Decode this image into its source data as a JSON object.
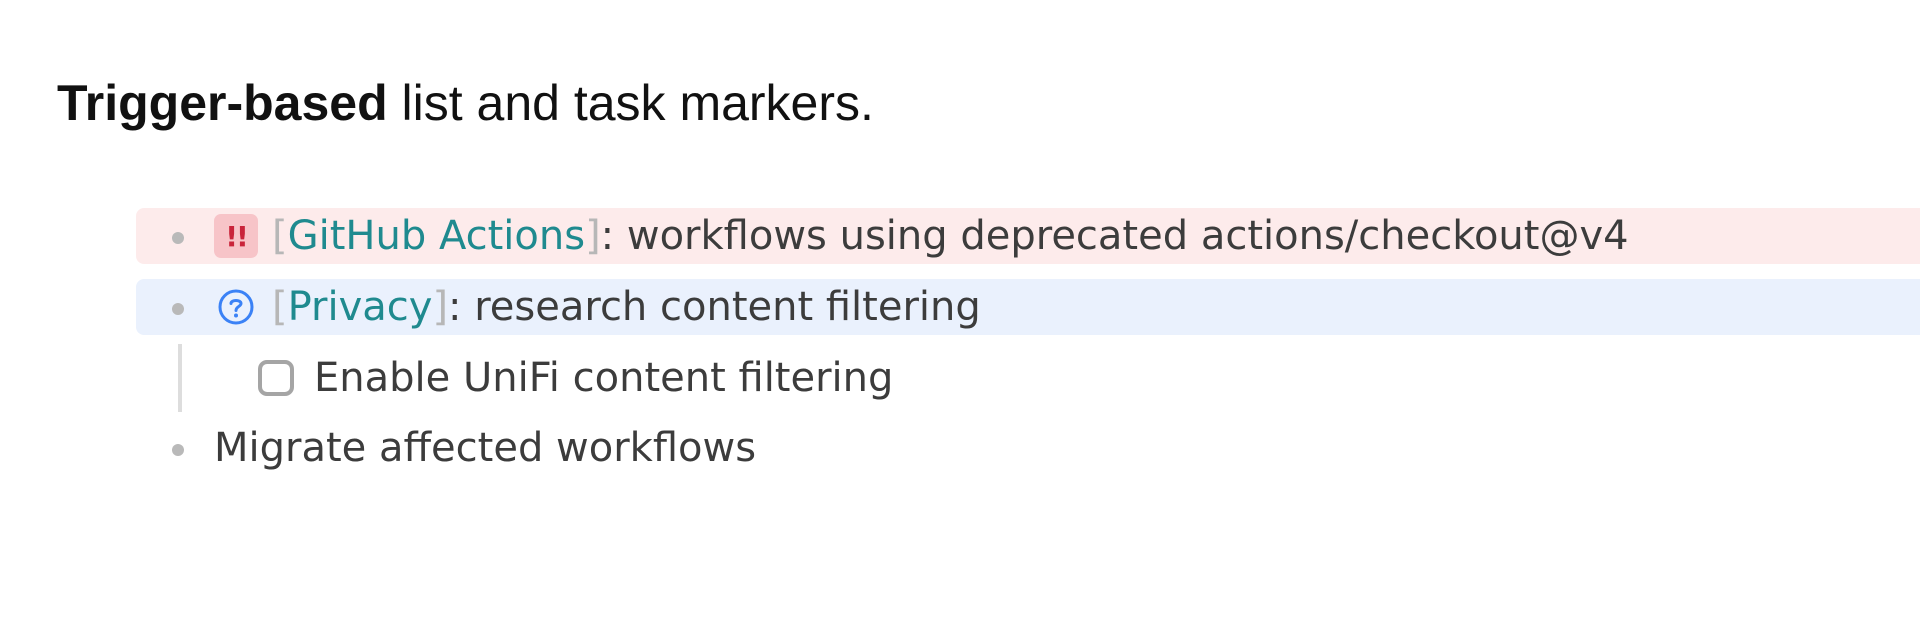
{
  "heading": {
    "bold": "Trigger-based",
    "rest": " list and task markers."
  },
  "items": [
    {
      "marker": "!!",
      "marker_icon": "double-exclamation-icon",
      "marker_color": "#c9243a",
      "highlight": "#fdebeb",
      "bracket_open": "[",
      "tag": "GitHub Actions",
      "bracket_close": "]",
      "text": ": workflows using deprecated actions/checkout@v4"
    },
    {
      "marker_icon": "question-circle-icon",
      "marker_color": "#3b82f6",
      "highlight": "#eaf1fd",
      "bracket_open": "[",
      "tag": "Privacy",
      "bracket_close": "]",
      "text": ": research content filtering",
      "subtasks": [
        {
          "label": "Enable UniFi content filtering",
          "checked": false
        }
      ]
    },
    {
      "text": "Migrate affected workflows"
    }
  ],
  "colors": {
    "tag": "#1f8a8f",
    "bracket": "#b7b7b7",
    "body_text": "#3c3c3c"
  }
}
